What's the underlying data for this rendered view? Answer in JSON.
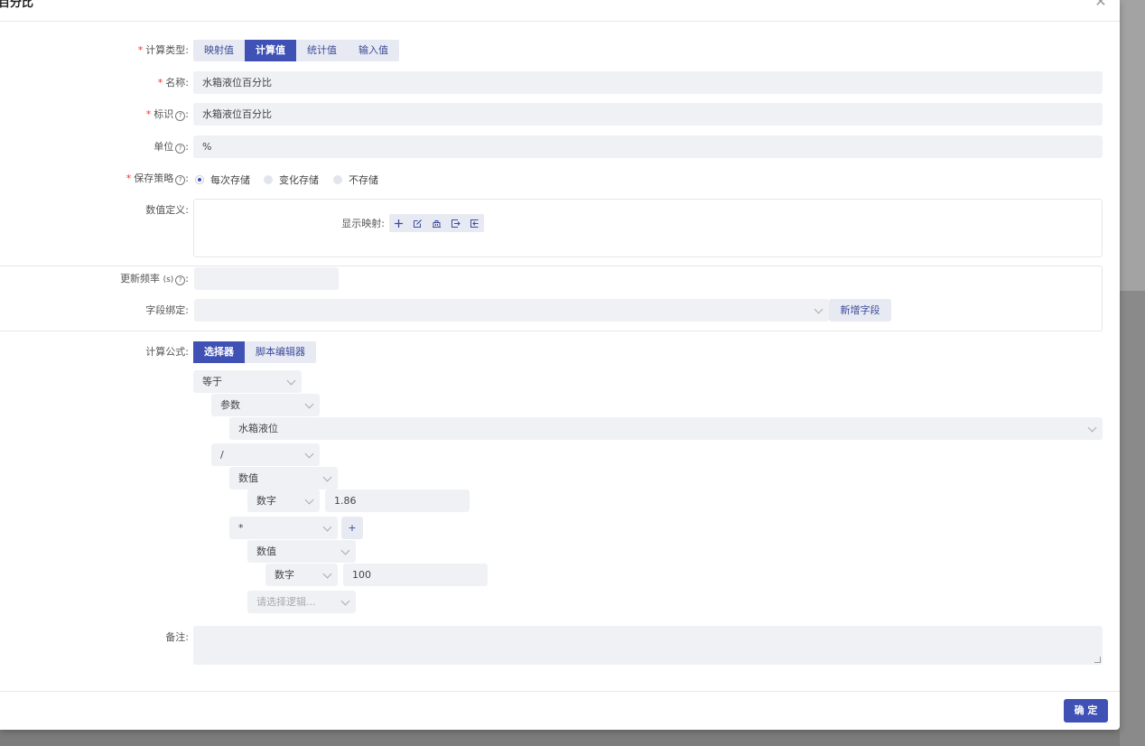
{
  "dialog": {
    "title": "百分比",
    "close_icon": "close-icon"
  },
  "form": {
    "calc_type": {
      "label": "计算类型:",
      "options": [
        "映射值",
        "计算值",
        "统计值",
        "输入值"
      ],
      "selected": "计算值"
    },
    "name": {
      "label": "名称:",
      "value": "水箱液位百分比"
    },
    "identifier": {
      "label": "标识",
      "value": "水箱液位百分比"
    },
    "unit": {
      "label": "单位",
      "value": "%"
    },
    "save_policy": {
      "label": "保存策略",
      "options": [
        "每次存储",
        "变化存储",
        "不存储"
      ],
      "selected": "每次存储"
    },
    "value_def": {
      "label": "数值定义:",
      "display_map_label": "显示映射:"
    },
    "update_freq": {
      "label": "更新频率",
      "unit": "(s)",
      "value": ""
    },
    "field_bind": {
      "label": "字段绑定:",
      "value": "",
      "add_button": "新增字段"
    },
    "formula": {
      "label": "计算公式:",
      "modes": [
        "选择器",
        "脚本编辑器"
      ],
      "selected": "选择器",
      "root_op": "等于",
      "param_type": "参数",
      "param_value": "水箱液位",
      "op_divide": "/",
      "value1_type": "数值",
      "value1_kind": "数字",
      "value1": "1.86",
      "op_multiply": "*",
      "add_symbol": "+",
      "value2_type": "数值",
      "value2_kind": "数字",
      "value2": "100",
      "logic_placeholder": "请选择逻辑..."
    },
    "remark": {
      "label": "备注:",
      "value": ""
    }
  },
  "footer": {
    "confirm": "确 定"
  },
  "colors": {
    "primary": "#3f51b5",
    "required": "#e53935",
    "field_bg": "#f0f1f4",
    "seg_bg": "#e8eaf3"
  }
}
